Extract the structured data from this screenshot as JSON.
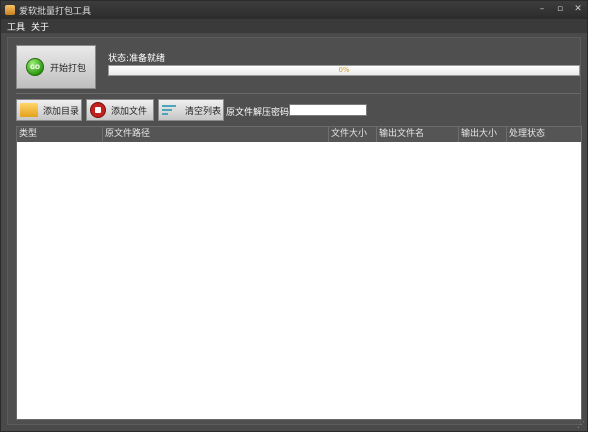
{
  "window": {
    "title": "爱软批量打包工具",
    "controls": {
      "minimize": "–",
      "maximize": "▫",
      "close": "✕"
    }
  },
  "menu": {
    "items": [
      "工具",
      "关于"
    ]
  },
  "pack": {
    "button_label": "开始打包",
    "icon_text": "GO",
    "status": "状态:准备就绪",
    "progress_percent": 0,
    "progress_label": "0%"
  },
  "toolbar": {
    "add_dir": "添加目录",
    "add_file": "添加文件",
    "clear_list": "清空列表",
    "password_label": "原文件解压密码",
    "password_value": ""
  },
  "table": {
    "columns": [
      "类型",
      "原文件路径",
      "文件大小",
      "输出文件名",
      "输出大小",
      "处理状态"
    ],
    "rows": []
  },
  "colors": {
    "window_bg": "#4a4a4a",
    "titlebar": "#2c2c2c",
    "progress_label": "#d19a2b",
    "go_icon": "#2f9a12",
    "add_file_icon": "#c42020"
  }
}
